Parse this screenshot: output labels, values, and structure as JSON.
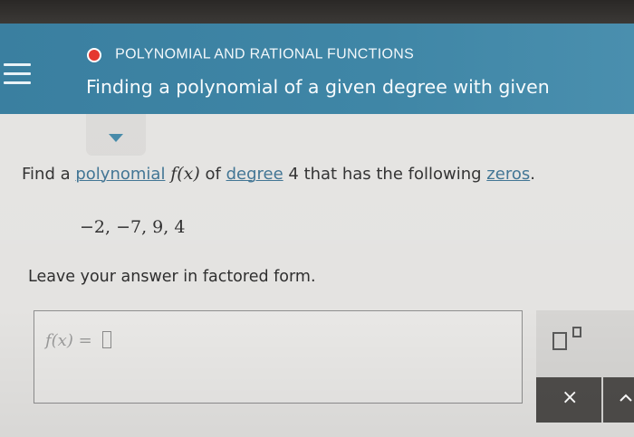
{
  "header": {
    "topic": "POLYNOMIAL AND RATIONAL FUNCTIONS",
    "title": "Finding a polynomial of a given degree with given"
  },
  "question": {
    "text_1": "Find a ",
    "term_polynomial": "polynomial",
    "function": "f(x)",
    "text_2": " of ",
    "term_degree": "degree",
    "degree_value": "4",
    "text_3": " that has the following ",
    "term_zeros": "zeros",
    "text_end": ".",
    "zeros_list": "−2, −7, 9, 4",
    "instruction": "Leave your answer in factored form."
  },
  "answer": {
    "prefix": "f(x) = "
  },
  "tools": {
    "exponent_icon": "exponent-template-icon",
    "clear_label": "×",
    "next_icon": "arrow-icon"
  },
  "colors": {
    "header_blue": "#3f86a6",
    "topic_dot_red": "#e5372f",
    "link_blue": "#3c7191",
    "tool_dark": "#4e4c4a"
  }
}
